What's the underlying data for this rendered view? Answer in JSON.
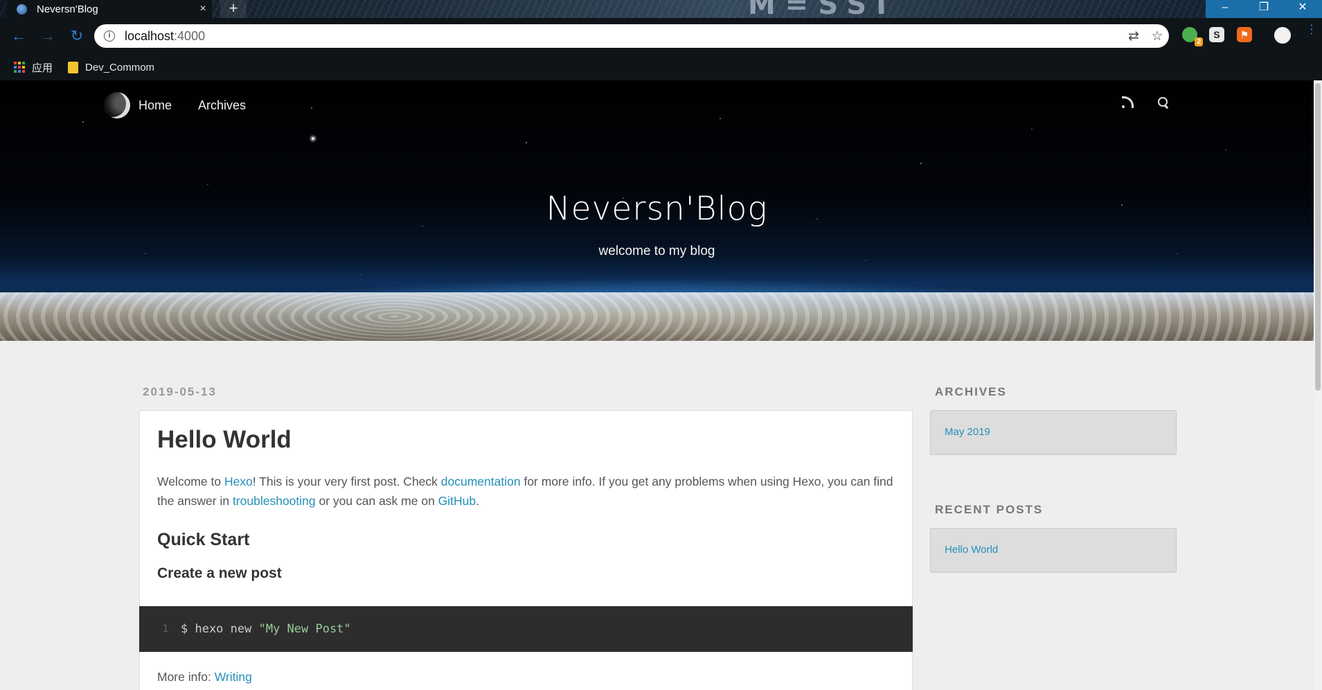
{
  "browser": {
    "tab_title": "Neversn'Blog",
    "tab_close": "×",
    "new_tab": "+",
    "url_host": "localhost",
    "url_port": ":4000",
    "info_glyph": "i",
    "extension_badge": "2",
    "ext2_label": "S",
    "ext3_label": "⚑",
    "wallpaper_text": "M=SSI",
    "bookmarks": [
      {
        "label": "应用"
      },
      {
        "label": "Dev_Commom"
      }
    ]
  },
  "site": {
    "nav": [
      {
        "label": "Home"
      },
      {
        "label": "Archives"
      }
    ],
    "title": "Neversn'Blog",
    "subtitle": "welcome to my blog"
  },
  "article": {
    "date": "2019-05-13",
    "title": "Hello World",
    "intro_parts": {
      "p1": "Welcome to ",
      "link1": "Hexo",
      "p2": "! This is your very first post. Check ",
      "link2": "documentation",
      "p3": " for more info. If you get any problems when using Hexo, you can find the answer in ",
      "link3": "troubleshooting",
      "p4": " or you can ask me on ",
      "link4": "GitHub",
      "p5": "."
    },
    "h2": "Quick Start",
    "h3": "Create a new post",
    "code": {
      "line_no": "1",
      "cmd": "$ hexo new ",
      "arg": "\"My New Post\""
    },
    "more_info_prefix": "More info: ",
    "more_info_link": "Writing"
  },
  "sidebar": {
    "archives_title": "ARCHIVES",
    "archives_item": "May 2019",
    "recent_title": "RECENT POSTS",
    "recent_item": "Hello World"
  },
  "colors": {
    "link": "#258fb8",
    "page_bg": "#eeeeee",
    "code_bg": "#2d2d2d",
    "chrome_bg": "#0f1419"
  }
}
